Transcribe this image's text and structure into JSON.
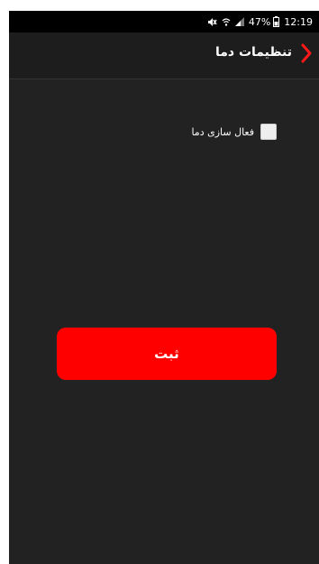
{
  "status_bar": {
    "battery": "47%",
    "time": "12:19",
    "icons": [
      "mute-icon",
      "wifi-icon",
      "signal-icon",
      "battery-icon"
    ]
  },
  "app_bar": {
    "title": "تنظیمات دما",
    "back_icon": "chevron-right-icon",
    "accent_color": "#ff1a1a"
  },
  "form": {
    "checkbox_label": "فعال سازی دما",
    "checkbox_checked": false
  },
  "submit": {
    "label": "ثبت",
    "color": "#ff0000"
  },
  "colors": {
    "background": "#222222",
    "app_bar": "#1d1d1d",
    "status_bar": "#000000"
  }
}
